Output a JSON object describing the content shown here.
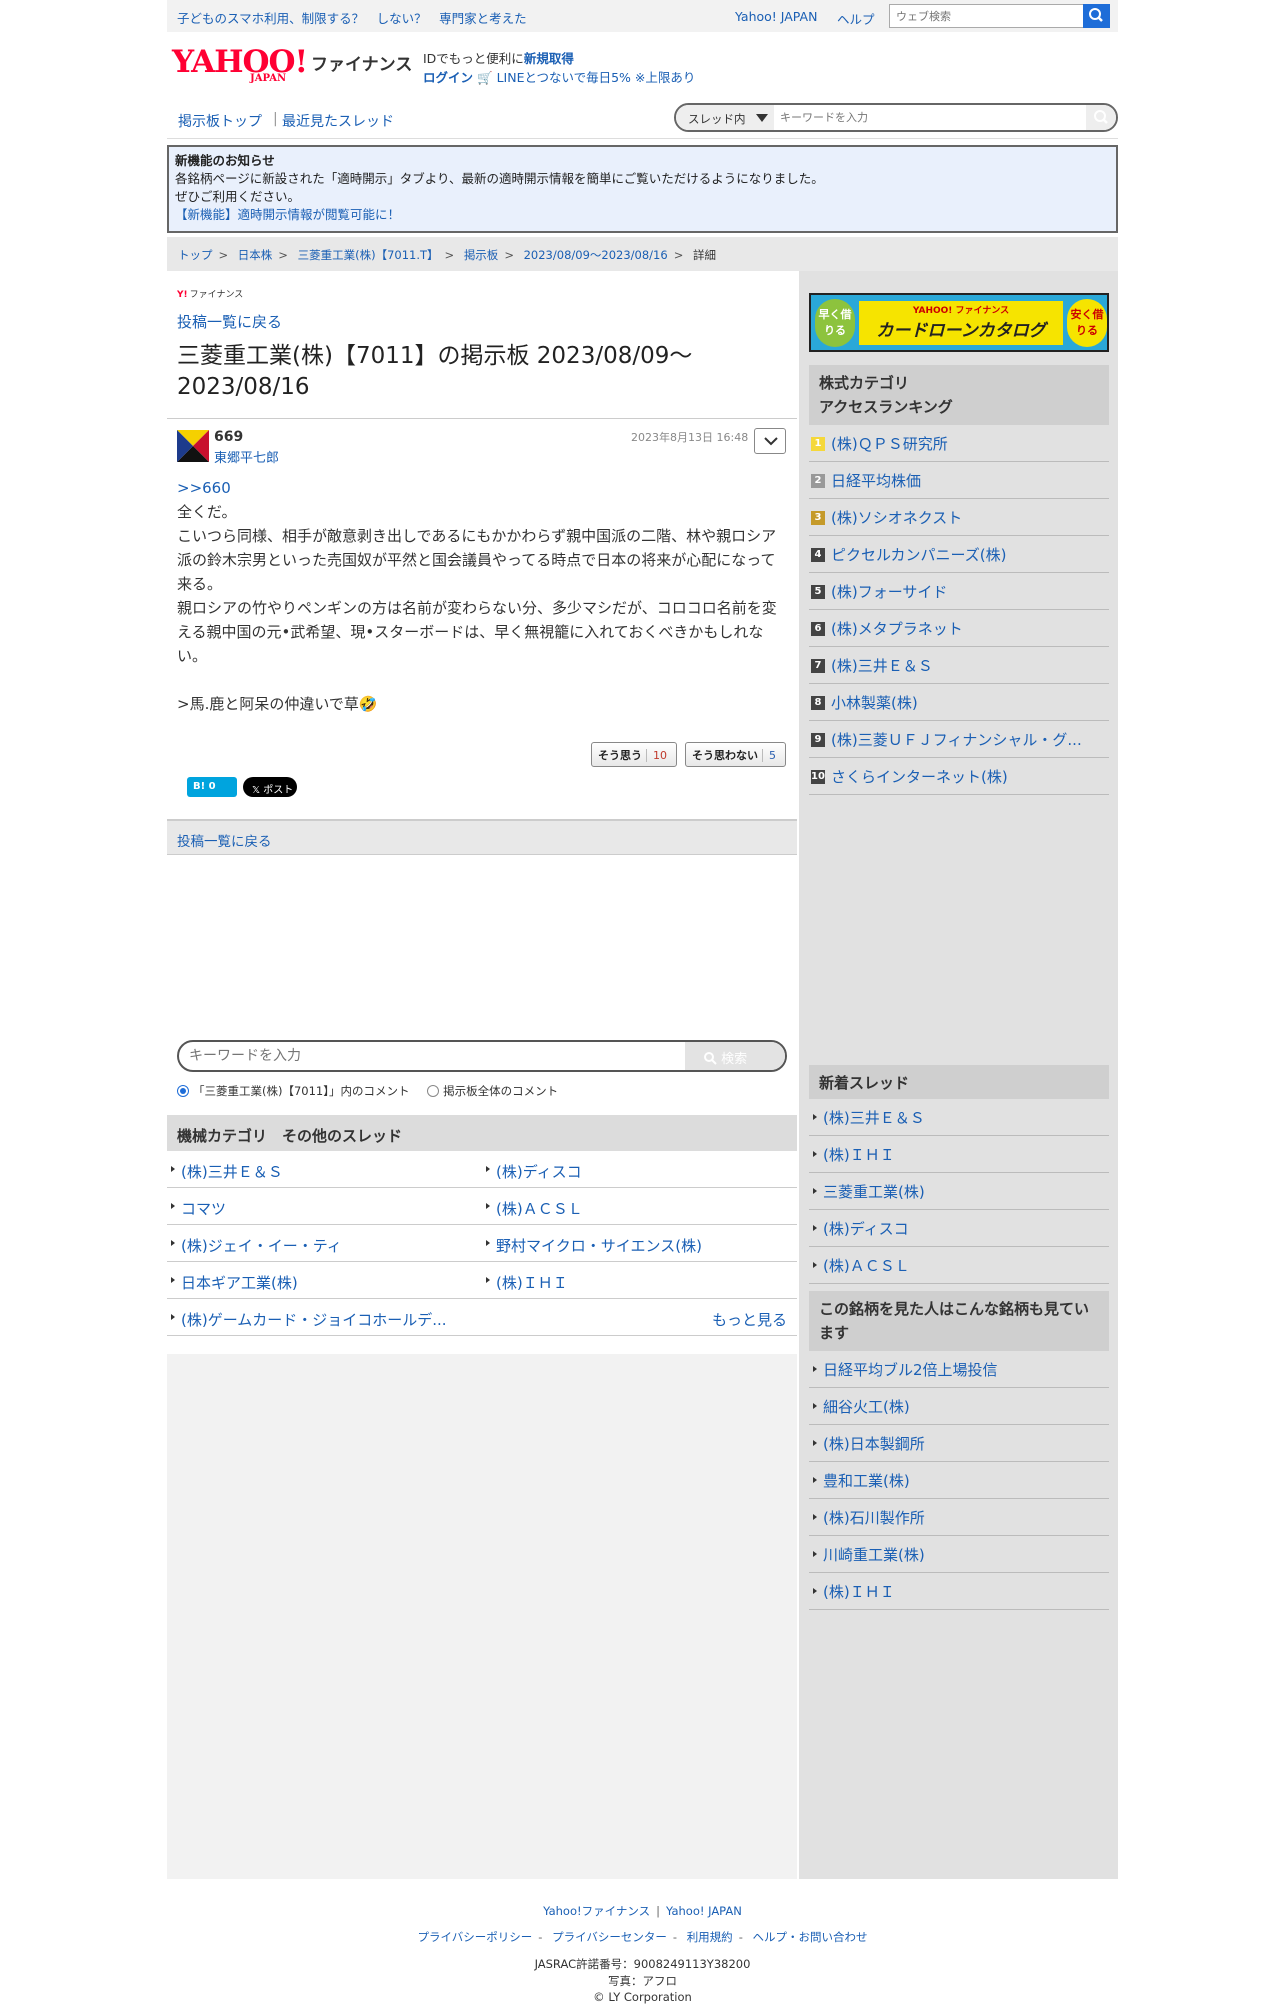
{
  "topbar": {
    "promo": "子どものスマホ利用、制限する？　しない？　専門家と考えた",
    "yahoo_japan": "Yahoo! JAPAN",
    "help": "ヘルプ",
    "search_placeholder": "ウェブ検索"
  },
  "header": {
    "logo": "YAHOO!",
    "logo_sub": "JAPAN",
    "finance": "ファイナンス",
    "id_text": "IDでもっと便利に",
    "id_link": "新規取得",
    "login": "ログイン",
    "line_text": "LINEとつないで毎日5% ※上限あり"
  },
  "nav": {
    "board_top": "掲示板トップ",
    "separator": "|",
    "recent": "最近見たスレッド",
    "scope": "スレッド内",
    "search_placeholder": "キーワードを入力"
  },
  "notice": {
    "title": "新機能のお知らせ",
    "body1": "各銘柄ページに新設された「適時開示」タブより、最新の適時開示情報を簡単にご覧いただけるようになりました。",
    "body2": "ぜひご利用ください。",
    "link": "【新機能】適時開示情報が閲覧可能に！"
  },
  "breadcrumb": [
    "トップ",
    "日本株",
    "三菱重工業(株)【7011.T】",
    "掲示板",
    "2023/08/09〜2023/08/16",
    "詳細"
  ],
  "breadcrumb_sep": ">",
  "left": {
    "yf_mark": "Y!",
    "yf_label": "ファイナンス",
    "back": "投稿一覧に戻る",
    "title": "三菱重工業(株)【7011】の掲示板 2023/08/09〜2023/08/16"
  },
  "post": {
    "number": "669",
    "author": "東郷平七郎",
    "date": "2023年8月13日 16:48",
    "reply_ref": ">>660",
    "line1": "全くだ。",
    "line2": "こいつら同様、相手が敵意剥き出しであるにもかかわらず親中国派の二階、林や親ロシア派の鈴木宗男といった売国奴が平然と国会議員やってる時点で日本の将来が心配になって来る。",
    "line3": "親ロシアの竹やりペンギンの方は名前が変わらない分、多少マシだが、コロコロ名前を変える親中国の元•武希望、現•スターボードは、早く無視籠に入れておくべきかもしれない。",
    "line4": ">馬.鹿と阿呆の仲違いで草🤣",
    "agree_label": "そう思う",
    "agree_count": "10",
    "disagree_label": "そう思わない",
    "disagree_count": "5",
    "hatena": "B! 0",
    "x_post": "𝕏 ポスト"
  },
  "lower": {
    "back": "投稿一覧に戻る",
    "search_placeholder": "キーワードを入力",
    "search_button": "検索",
    "radio_thread": "「三菱重工業(株)【7011】」内のコメント",
    "radio_all": "掲示板全体のコメント"
  },
  "category": {
    "title": "機械カテゴリ　その他のスレッド",
    "left": [
      "(株)三井Ｅ＆Ｓ",
      "コマツ",
      "(株)ジェイ・イー・ティ",
      "日本ギア工業(株)",
      "(株)ゲームカード・ジョイコホールデ..."
    ],
    "right": [
      "(株)ディスコ",
      "(株)ＡＣＳＬ",
      "野村マイクロ・サイエンス(株)",
      "(株)ＩＨＩ"
    ],
    "more": "もっと見る"
  },
  "right": {
    "banner_left": "早く借りる",
    "banner_brand": "YAHOO! ファイナンス",
    "banner_main": "カードローンカタログ",
    "banner_right": "安く借りる",
    "ranking_title_1": "株式カテゴリ",
    "ranking_title_2": "アクセスランキング",
    "ranking": [
      "(株)ＱＰＳ研究所",
      "日経平均株価",
      "(株)ソシオネクスト",
      "ピクセルカンパニーズ(株)",
      "(株)フォーサイド",
      "(株)メタプラネット",
      "(株)三井Ｅ＆Ｓ",
      "小林製薬(株)",
      "(株)三菱ＵＦＪフィナンシャル・グ...",
      "さくらインターネット(株)"
    ],
    "new_title": "新着スレッド",
    "new_threads": [
      "(株)三井Ｅ＆Ｓ",
      "(株)ＩＨＩ",
      "三菱重工業(株)",
      "(株)ディスコ",
      "(株)ＡＣＳＬ"
    ],
    "also_title": "この銘柄を見た人はこんな銘柄も見ています",
    "also": [
      "日経平均ブル2倍上場投信",
      "細谷火工(株)",
      "(株)日本製鋼所",
      "豊和工業(株)",
      "(株)石川製作所",
      "川崎重工業(株)",
      "(株)ＩＨＩ"
    ]
  },
  "footer": {
    "yf": "Yahoo!ファイナンス",
    "yj": "Yahoo! JAPAN",
    "privacy": "プライバシーポリシー",
    "privacy_center": "プライバシーセンター",
    "terms": "利用規約",
    "help": "ヘルプ・お問い合わせ",
    "jasrac": "JASRAC許諾番号：9008249113Y38200",
    "photo": "写真：アフロ",
    "copyright": "© LY Corporation"
  },
  "colors": {
    "accent": "#1e6dd8",
    "link": "#1a5fb4",
    "brand_red": "#ff0033"
  }
}
